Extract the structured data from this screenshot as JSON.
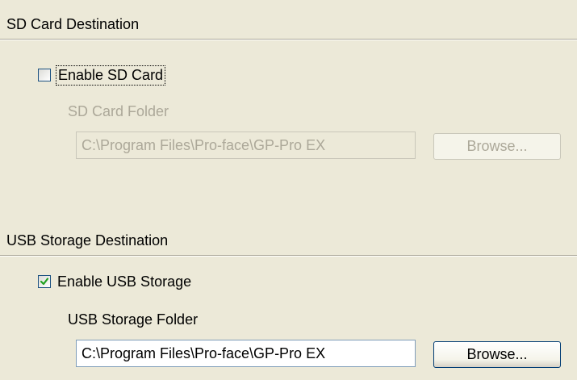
{
  "sd_section": {
    "header": "SD Card Destination",
    "enable_label": "Enable SD Card",
    "enable_checked": false,
    "folder_label": "SD Card Folder",
    "folder_value": "C:\\Program Files\\Pro-face\\GP-Pro EX",
    "browse_label": "Browse..."
  },
  "usb_section": {
    "header": "USB Storage Destination",
    "enable_label": "Enable USB Storage",
    "enable_checked": true,
    "folder_label": "USB Storage Folder",
    "folder_value": "C:\\Program Files\\Pro-face\\GP-Pro EX",
    "browse_label": "Browse..."
  },
  "colors": {
    "background": "#ECE9D8",
    "disabled_text": "#ACA899",
    "checkmark": "#21A121",
    "input_border": "#7F9DB9"
  }
}
